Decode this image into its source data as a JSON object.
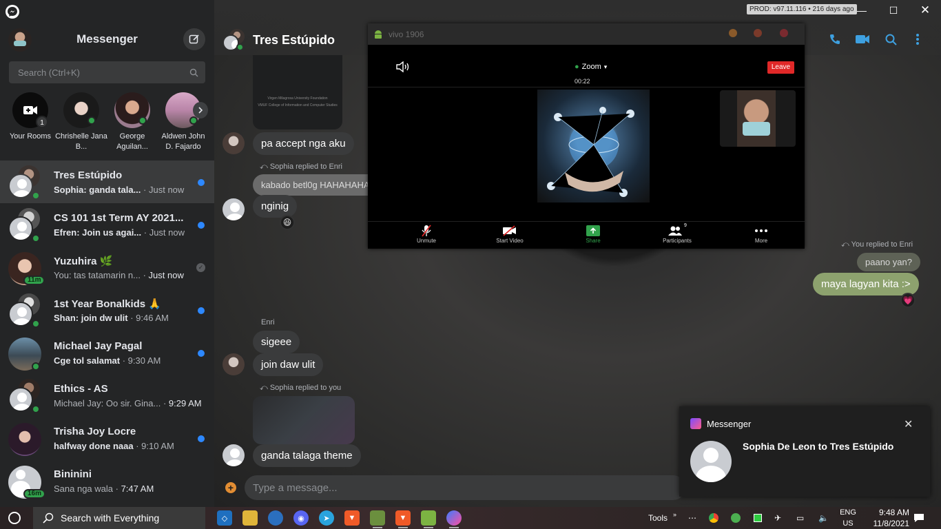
{
  "window": {
    "prod_badge": "PROD: v97.11.116 • 216 days ago"
  },
  "sidebar": {
    "title": "Messenger",
    "search_placeholder": "Search (Ctrl+K)",
    "rooms": [
      {
        "name": "Your Rooms",
        "badge": "1"
      },
      {
        "name": "Chrishelle Jana B..."
      },
      {
        "name": "George Aguilan..."
      },
      {
        "name": "Aldwen John D. Fajardo"
      }
    ],
    "conversations": [
      {
        "name": "Tres Estúpido",
        "preview": "Sophia: ganda tala...",
        "time": "Just now",
        "unread": true,
        "active": true
      },
      {
        "name": "CS 101 1st Term AY 2021...",
        "preview": "Efren: Join us agai...",
        "time": "Just now",
        "unread": true
      },
      {
        "name": "Yuzuhira 🌿",
        "preview": "You: tas tatamarin n...",
        "time": "Just now",
        "unread": false,
        "badge": "11m"
      },
      {
        "name": "1st Year Bonalkids 🙏",
        "preview": "Shan: join dw ulit",
        "time": "9:46 AM",
        "unread": true
      },
      {
        "name": "Michael Jay Pagal",
        "preview": "Cge tol salamat",
        "time": "9:30 AM",
        "unread": true
      },
      {
        "name": "Ethics - AS",
        "preview": "Michael Jay: Oo sir. Gina...",
        "time": "9:29 AM",
        "unread": false
      },
      {
        "name": "Trisha Joy Locre",
        "preview": "halfway done naaa",
        "time": "9:10 AM",
        "unread": true
      },
      {
        "name": "Bininini",
        "preview": "Sana nga wala",
        "time": "7:47 AM",
        "unread": false,
        "badge": "16m"
      }
    ]
  },
  "chat": {
    "title": "Tres Estúpido",
    "image_card_text": "Virgen Milagrosa University Foundation",
    "image_card_sub": "VMUF College of Information and Computer Studies",
    "messages": {
      "m1": "pa accept nga aku",
      "reply1_label": "Sophia replied to Enri",
      "reply1_quote": "kabado betl0g HAHAHAHA",
      "m2": "nginig",
      "reply2_label": "You replied to Enri",
      "reply2_quote": "paano yan?",
      "m3": "maya lagyan kita :>",
      "sender_enri": "Enri",
      "m4": "sigeee",
      "m5": "join daw ulit",
      "reply3_label": "Sophia replied to you",
      "m6": "ganda talaga theme"
    },
    "composer_placeholder": "Type a message..."
  },
  "zoom": {
    "window_title": "vivo 1906",
    "app_label": "Zoom",
    "timer": "00:22",
    "leave_label": "Leave",
    "tools": [
      {
        "label": "Unmute"
      },
      {
        "label": "Start Video"
      },
      {
        "label": "Share"
      },
      {
        "label": "Participants",
        "count": "9"
      },
      {
        "label": "More"
      }
    ]
  },
  "notification": {
    "app": "Messenger",
    "title": "Sophia De Leon to Tres Estúpido"
  },
  "taskbar": {
    "search_label": "Search with Everything",
    "tools_label": "Tools",
    "lang_top": "ENG",
    "lang_bottom": "US",
    "time": "9:48 AM",
    "date": "11/8/2021"
  },
  "colors": {
    "accent_blue": "#2d88ff",
    "online_green": "#31a24c",
    "outgoing_bubble": "#8da26e",
    "zoom_leave": "#e02828"
  }
}
